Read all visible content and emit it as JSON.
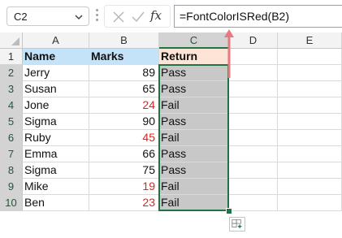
{
  "formula_bar": {
    "name_box": "C2",
    "formula": "=FontColorISRed(B2)",
    "fx_label": "fx"
  },
  "columns": [
    "A",
    "B",
    "C",
    "D",
    "E"
  ],
  "headers": {
    "name": "Name",
    "marks": "Marks",
    "return": "Return"
  },
  "rows": [
    {
      "num": "1"
    },
    {
      "num": "2",
      "name": "Jerry",
      "marks": "89",
      "marks_color": "#111111",
      "ret": "Pass"
    },
    {
      "num": "3",
      "name": "Susan",
      "marks": "65",
      "marks_color": "#111111",
      "ret": "Pass"
    },
    {
      "num": "4",
      "name": "Jone",
      "marks": "24",
      "marks_color": "#e0241b",
      "ret": "Fail"
    },
    {
      "num": "5",
      "name": "Sigma",
      "marks": "90",
      "marks_color": "#111111",
      "ret": "Pass"
    },
    {
      "num": "6",
      "name": "Ruby",
      "marks": "45",
      "marks_color": "#e0241b",
      "ret": "Fail"
    },
    {
      "num": "7",
      "name": "Emma",
      "marks": "66",
      "marks_color": "#111111",
      "ret": "Pass"
    },
    {
      "num": "8",
      "name": "Sigma",
      "marks": "75",
      "marks_color": "#111111",
      "ret": "Pass"
    },
    {
      "num": "9",
      "name": "Mike",
      "marks": "19",
      "marks_color": "#e0241b",
      "ret": "Fail"
    },
    {
      "num": "10",
      "name": "Ben",
      "marks": "23",
      "marks_color": "#e0241b",
      "ret": "Fail"
    }
  ],
  "colors": {
    "header_fill": "#c5e3f8",
    "return_header_fill": "#fce4d6",
    "selected_fill": "#c8c8c8",
    "accent": "#217346",
    "arrow": "#e8797f"
  }
}
